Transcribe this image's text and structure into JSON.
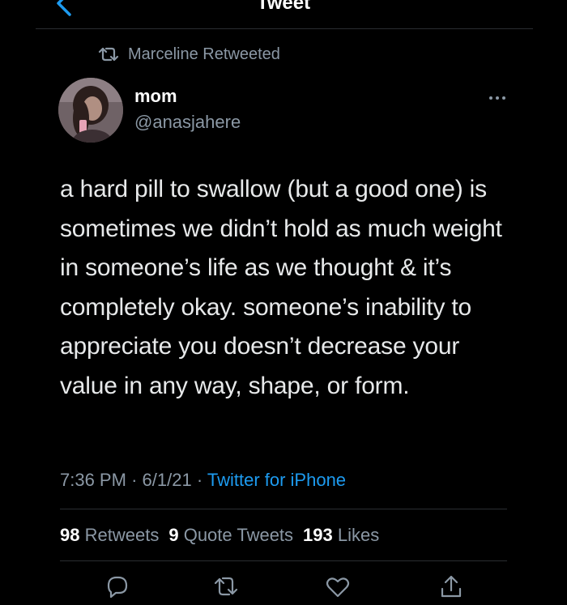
{
  "header": {
    "title": "Tweet"
  },
  "retweet_context": {
    "text": "Marceline Retweeted"
  },
  "tweet": {
    "author_name": "mom",
    "author_handle": "@anasjahere",
    "text": "a hard pill to swallow (but a good one) is sometimes we didn’t hold as much weight in someone’s life as we thought & it’s completely okay. someone’s inability to appreciate you doesn’t decrease your value in any way, shape, or form.",
    "time": "7:36 PM",
    "date": "6/1/21",
    "separator": "·",
    "source": "Twitter for iPhone"
  },
  "stats": {
    "retweets_count": "98",
    "retweets_label": "Retweets",
    "quotes_count": "9",
    "quotes_label": "Quote Tweets",
    "likes_count": "193",
    "likes_label": "Likes"
  },
  "icons": {
    "back": "chevron-left-icon",
    "retweet": "retweet-icon",
    "more": "more-horizontal-icon",
    "reply": "reply-icon",
    "like": "heart-icon",
    "share": "share-icon"
  },
  "colors": {
    "background": "#000000",
    "text": "#e7e9ea",
    "secondary": "#8b98a5",
    "accent": "#1d9bf0"
  }
}
